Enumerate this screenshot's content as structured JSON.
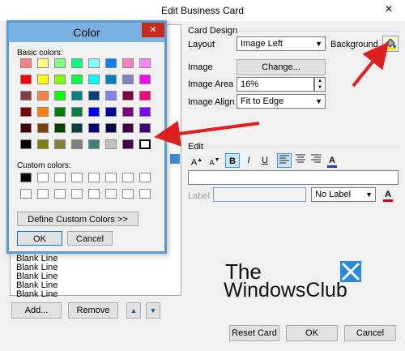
{
  "window": {
    "title": "Edit Business Card",
    "close_glyph": "✕"
  },
  "card_design": {
    "header": "Card Design",
    "layout_label": "Layout",
    "layout_value": "Image Left",
    "background_label": "Background",
    "image_label": "Image",
    "change_button": "Change...",
    "image_area_label": "Image Area",
    "image_area_value": "16%",
    "image_align_label": "Image Align",
    "image_align_value": "Fit to Edge"
  },
  "edit": {
    "header": "Edit",
    "font_grow": "A",
    "font_shrink": "A",
    "bold": "B",
    "italic": "I",
    "underline": "U",
    "font_color": "A",
    "label_label": "Label",
    "label_value": "No Label",
    "label_color": "A"
  },
  "fields": {
    "items": [
      "Blank Line",
      "Blank Line",
      "Blank Line",
      "Blank Line",
      "Blank Line"
    ],
    "add_button": "Add...",
    "remove_button": "Remove",
    "up_glyph": "▲",
    "down_glyph": "▼"
  },
  "footer": {
    "reset_button": "Reset Card",
    "ok_button": "OK",
    "cancel_button": "Cancel"
  },
  "color_dialog": {
    "title": "Color",
    "close_glyph": "✕",
    "basic_colors_label": "Basic colors:",
    "custom_colors_label": "Custom colors:",
    "define_button": "Define Custom Colors >>",
    "ok_button": "OK",
    "cancel_button": "Cancel",
    "basic_colors": [
      [
        "#ff8080",
        "#ffff80",
        "#80ff80",
        "#00ff80",
        "#80ffff",
        "#0080ff",
        "#ff80c0",
        "#ff80ff"
      ],
      [
        "#ff0000",
        "#ffff00",
        "#80ff00",
        "#00ff40",
        "#00ffff",
        "#0080c0",
        "#8080c0",
        "#ff00ff"
      ],
      [
        "#804040",
        "#ff8040",
        "#00ff00",
        "#008080",
        "#004080",
        "#8080ff",
        "#800040",
        "#ff0080"
      ],
      [
        "#800000",
        "#ff8000",
        "#008000",
        "#008040",
        "#0000ff",
        "#0000a0",
        "#800080",
        "#8000ff"
      ],
      [
        "#400000",
        "#804000",
        "#004000",
        "#004040",
        "#000080",
        "#000040",
        "#400040",
        "#400080"
      ],
      [
        "#000000",
        "#808000",
        "#808040",
        "#808080",
        "#408080",
        "#c0c0c0",
        "#400040",
        "#ffffff"
      ]
    ]
  },
  "watermark": {
    "line1": "The",
    "line2": "WindowsClub"
  },
  "colors": {
    "accent_blue": "#0078d7",
    "arrow_red": "#e02020",
    "dialog_border": "#5b9bd5"
  }
}
